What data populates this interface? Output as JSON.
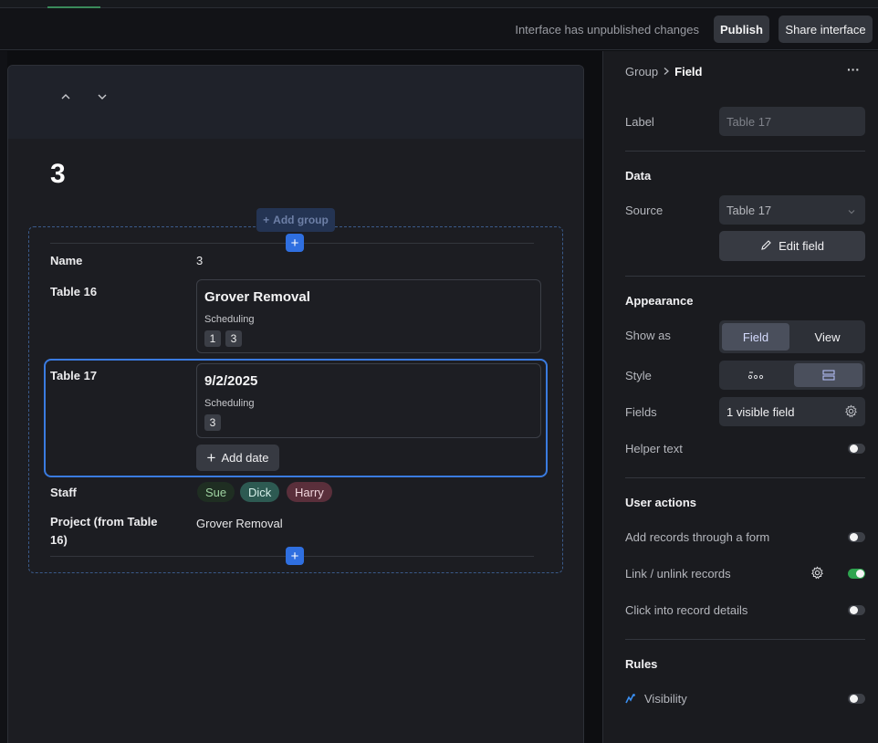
{
  "topbar": {
    "status_text": "Interface has unpublished changes",
    "publish_label": "Publish",
    "share_label": "Share interface"
  },
  "record": {
    "title": "3",
    "add_group_label": "Add group",
    "fields": {
      "name": {
        "label": "Name",
        "value": "3"
      },
      "table16": {
        "label": "Table 16",
        "card_title": "Grover Removal",
        "card_sub": "Scheduling",
        "chips": [
          "1",
          "3"
        ]
      },
      "table17": {
        "label": "Table 17",
        "card_title": "9/2/2025",
        "card_sub": "Scheduling",
        "chips": [
          "3"
        ],
        "add_label": "Add date"
      },
      "staff": {
        "label": "Staff",
        "values": [
          "Sue",
          "Dick",
          "Harry"
        ]
      },
      "project": {
        "label": "Project (from Table 16)",
        "value": "Grover Removal"
      }
    }
  },
  "panel": {
    "breadcrumb_parent": "Group",
    "breadcrumb_current": "Field",
    "more_glyph": "···",
    "label_label": "Label",
    "label_placeholder": "Table 17",
    "data_heading": "Data",
    "source_label": "Source",
    "source_value": "Table 17",
    "edit_field_label": "Edit field",
    "appearance_heading": "Appearance",
    "show_as_label": "Show as",
    "show_as_options": [
      "Field",
      "View"
    ],
    "show_as_selected": "Field",
    "style_label": "Style",
    "fields_label": "Fields",
    "fields_value": "1 visible field",
    "helper_text_label": "Helper text",
    "helper_text_on": false,
    "user_actions_heading": "User actions",
    "add_records_label": "Add records through a form",
    "add_records_on": false,
    "link_unlink_label": "Link / unlink records",
    "link_unlink_on": true,
    "click_into_label": "Click into record details",
    "click_into_on": false,
    "rules_heading": "Rules",
    "visibility_label": "Visibility",
    "visibility_on": false
  },
  "colors": {
    "accent_blue": "#2f6fe0",
    "toggle_on": "#2ea44f"
  }
}
